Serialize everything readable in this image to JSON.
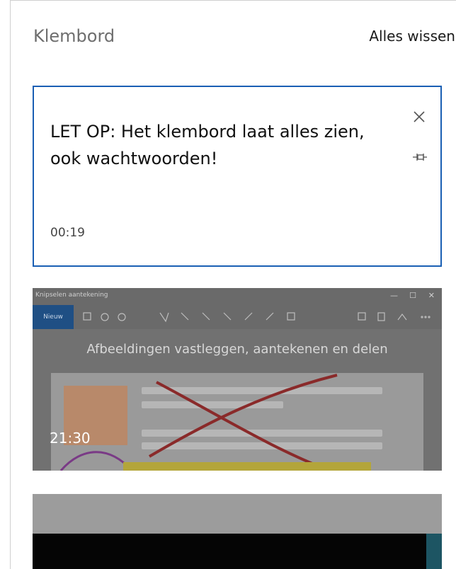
{
  "header": {
    "title": "Klembord",
    "clear_all_label": "Alles wissen"
  },
  "items": [
    {
      "type": "text",
      "text": "LET OP: Het klembord laat alles zien, ook wachtwoorden!",
      "time": "00:19",
      "selected": true,
      "close_icon": "close-icon",
      "pin_icon": "pin-icon"
    },
    {
      "type": "image",
      "time": "21:30",
      "thumbnail": {
        "window_title": "Knipselen aantekening",
        "new_button": "Nieuw",
        "headline": "Afbeeldingen vastleggen, aantekenen en delen"
      }
    },
    {
      "type": "image"
    }
  ],
  "colors": {
    "accent": "#1a5fb4",
    "panel_bg": "#ffffff"
  }
}
